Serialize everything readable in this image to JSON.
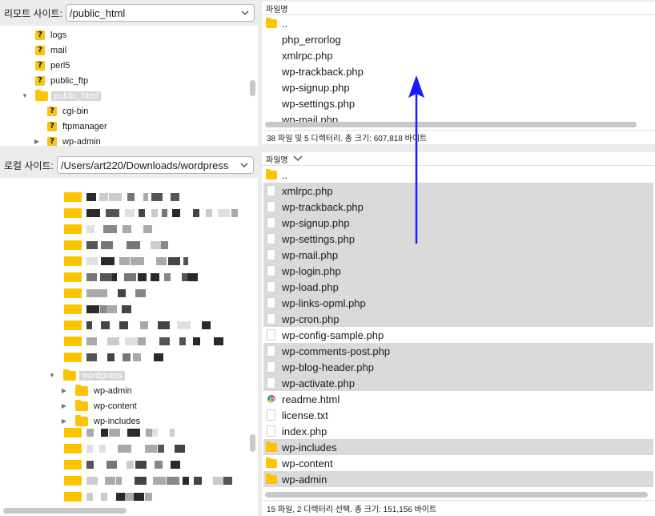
{
  "remote": {
    "label": "리모트 사이트:",
    "path": "/public_html",
    "tree": [
      {
        "name": "logs",
        "icon": "question-icon"
      },
      {
        "name": "mail",
        "icon": "question-icon"
      },
      {
        "name": "perl5",
        "icon": "question-icon"
      },
      {
        "name": "public_ftp",
        "icon": "question-icon"
      },
      {
        "name": "public_html",
        "icon": "folder-icon",
        "selected": true
      },
      {
        "name": "cgi-bin",
        "icon": "question-icon"
      },
      {
        "name": "ftpmanager",
        "icon": "question-icon"
      },
      {
        "name": "wp-admin",
        "icon": "question-icon"
      }
    ],
    "list_header": "파일명",
    "files": [
      "..",
      "php_errorlog",
      "xmlrpc.php",
      "wp-trackback.php",
      "wp-signup.php",
      "wp-settings.php",
      "wp-mail.php"
    ],
    "status": "38 파일 및 5 디렉터리. 총 크기: 607,818 바이트"
  },
  "local": {
    "label": "로컬 사이트:",
    "path": "/Users/art220/Downloads/wordpress",
    "tree_selected": "wordpress",
    "tree_children": [
      "wp-admin",
      "wp-content",
      "wp-includes"
    ],
    "list_header": "파일명",
    "files": [
      {
        "name": "..",
        "type": "folder",
        "selected": false
      },
      {
        "name": "xmlrpc.php",
        "type": "file",
        "selected": true
      },
      {
        "name": "wp-trackback.php",
        "type": "file",
        "selected": true
      },
      {
        "name": "wp-signup.php",
        "type": "file",
        "selected": true
      },
      {
        "name": "wp-settings.php",
        "type": "file",
        "selected": true
      },
      {
        "name": "wp-mail.php",
        "type": "file",
        "selected": true
      },
      {
        "name": "wp-login.php",
        "type": "file",
        "selected": true
      },
      {
        "name": "wp-load.php",
        "type": "file",
        "selected": true
      },
      {
        "name": "wp-links-opml.php",
        "type": "file",
        "selected": true
      },
      {
        "name": "wp-cron.php",
        "type": "file",
        "selected": true
      },
      {
        "name": "wp-config-sample.php",
        "type": "file",
        "selected": false
      },
      {
        "name": "wp-comments-post.php",
        "type": "file",
        "selected": true
      },
      {
        "name": "wp-blog-header.php",
        "type": "file",
        "selected": true
      },
      {
        "name": "wp-activate.php",
        "type": "file",
        "selected": true
      },
      {
        "name": "readme.html",
        "type": "chrome",
        "selected": false
      },
      {
        "name": "license.txt",
        "type": "file",
        "selected": false
      },
      {
        "name": "index.php",
        "type": "file",
        "selected": false
      },
      {
        "name": "wp-includes",
        "type": "folder",
        "selected": true
      },
      {
        "name": "wp-content",
        "type": "folder",
        "selected": false
      },
      {
        "name": "wp-admin",
        "type": "folder",
        "selected": true
      }
    ],
    "status": "15 파일, 2 디렉터리 선택. 총 크기: 151,156 바이트"
  },
  "icons": {
    "dropdown": "chevron-down-icon",
    "upload_arrow": "upload-arrow-icon"
  },
  "colors": {
    "folder": "#ffc400",
    "arrow": "#1a1aff",
    "selection": "#dadada"
  }
}
